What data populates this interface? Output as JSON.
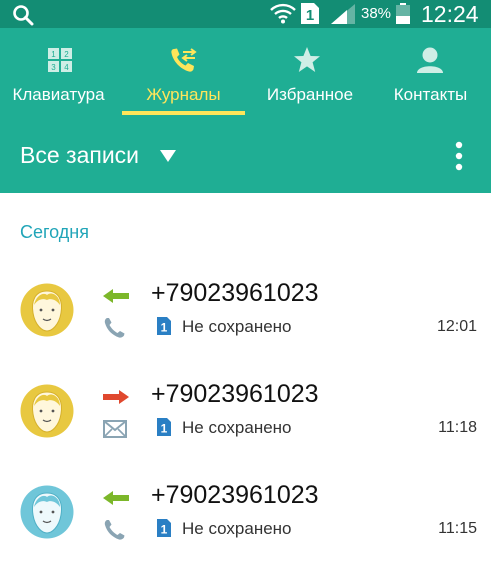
{
  "status_bar": {
    "battery_percent": "38%",
    "time": "12:24",
    "sim_slot": "1",
    "icons": [
      "search-icon",
      "wifi-icon",
      "sim-icon",
      "signal-icon",
      "battery-icon"
    ]
  },
  "tabs": [
    {
      "label": "Клавиатура",
      "icon": "keypad-icon",
      "active": false
    },
    {
      "label": "Журналы",
      "icon": "call-log-icon",
      "active": true
    },
    {
      "label": "Избранное",
      "icon": "star-icon",
      "active": false
    },
    {
      "label": "Контакты",
      "icon": "contacts-icon",
      "active": false
    }
  ],
  "filter": {
    "label": "Все записи"
  },
  "log": {
    "section_header": "Сегодня",
    "entries": [
      {
        "number": "+79023961023",
        "status": "Не сохранено",
        "time": "12:01",
        "direction": "incoming",
        "type": "call",
        "sim": "1",
        "avatar_color": "#e8c840"
      },
      {
        "number": "+79023961023",
        "status": "Не сохранено",
        "time": "11:18",
        "direction": "outgoing",
        "type": "message",
        "sim": "1",
        "avatar_color": "#e8c840"
      },
      {
        "number": "+79023961023",
        "status": "Не сохранено",
        "time": "11:15",
        "direction": "incoming",
        "type": "call",
        "sim": "1",
        "avatar_color": "#6fc6d9"
      }
    ]
  },
  "colors": {
    "status_bar": "#138d74",
    "toolbar": "#1fae94",
    "active_tab": "#ffe55a",
    "section_header": "#21a5b8",
    "incoming_arrow": "#7cb72a",
    "outgoing_arrow": "#e0482e",
    "sim_badge": "#2a7fc4"
  }
}
